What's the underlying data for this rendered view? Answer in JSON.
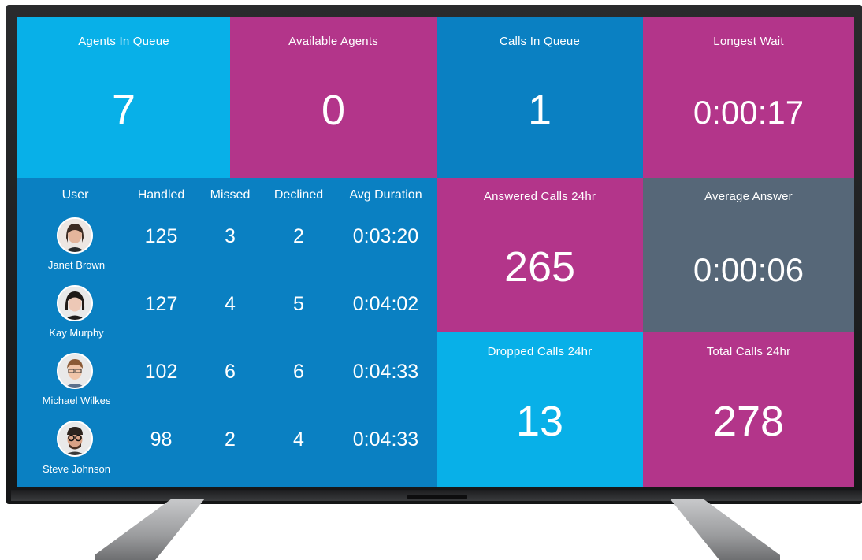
{
  "tiles": {
    "agents_in_queue": {
      "label": "Agents In Queue",
      "value": "7"
    },
    "available_agents": {
      "label": "Available Agents",
      "value": "0"
    },
    "calls_in_queue": {
      "label": "Calls In Queue",
      "value": "1"
    },
    "longest_wait": {
      "label": "Longest Wait",
      "value": "0:00:17"
    },
    "answered_calls": {
      "label": "Answered Calls 24hr",
      "value": "265"
    },
    "average_answer": {
      "label": "Average Answer",
      "value": "0:00:06"
    },
    "dropped_calls": {
      "label": "Dropped Calls 24hr",
      "value": "13"
    },
    "total_calls": {
      "label": "Total Calls 24hr",
      "value": "278"
    }
  },
  "agents_table": {
    "headers": [
      "User",
      "Handled",
      "Missed",
      "Declined",
      "Avg Duration"
    ],
    "rows": [
      {
        "name": "Janet Brown",
        "handled": "125",
        "missed": "3",
        "declined": "2",
        "avg_duration": "0:03:20"
      },
      {
        "name": "Kay Murphy",
        "handled": "127",
        "missed": "4",
        "declined": "5",
        "avg_duration": "0:04:02"
      },
      {
        "name": "Michael Wilkes",
        "handled": "102",
        "missed": "6",
        "declined": "6",
        "avg_duration": "0:04:33"
      },
      {
        "name": "Steve Johnson",
        "handled": "98",
        "missed": "2",
        "declined": "4",
        "avg_duration": "0:04:33"
      }
    ]
  },
  "colors": {
    "cyan": "#08b0e8",
    "magenta": "#b3358a",
    "blue": "#0a80c2",
    "slate": "#566778"
  },
  "icons": [
    "avatar-photo-icon"
  ]
}
